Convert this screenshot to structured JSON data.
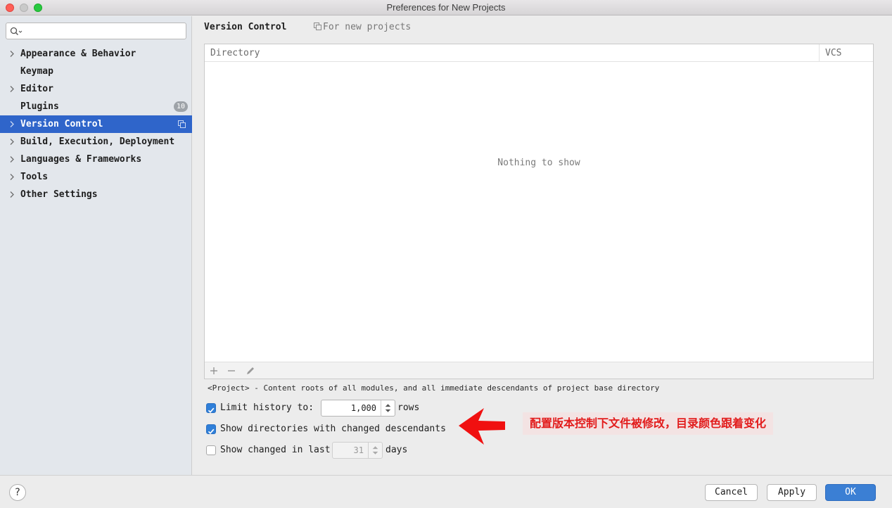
{
  "window": {
    "title": "Preferences for New Projects"
  },
  "sidebar": {
    "search_placeholder": "",
    "items": [
      {
        "label": "Appearance & Behavior",
        "expandable": true
      },
      {
        "label": "Keymap",
        "expandable": false
      },
      {
        "label": "Editor",
        "expandable": true
      },
      {
        "label": "Plugins",
        "expandable": false,
        "badge": "10"
      },
      {
        "label": "Version Control",
        "expandable": true,
        "selected": true
      },
      {
        "label": "Build, Execution, Deployment",
        "expandable": true
      },
      {
        "label": "Languages & Frameworks",
        "expandable": true
      },
      {
        "label": "Tools",
        "expandable": true
      },
      {
        "label": "Other Settings",
        "expandable": true
      }
    ]
  },
  "main": {
    "title": "Version Control",
    "scope_note": "For new projects",
    "table": {
      "columns": [
        "Directory",
        "VCS"
      ],
      "rows": [],
      "empty_text": "Nothing to show",
      "toolbar_icons": [
        "plus-icon",
        "minus-icon",
        "pencil-icon"
      ]
    },
    "hint": "<Project> - Content roots of all modules, and all immediate descendants of project base directory",
    "options": {
      "limit_history": {
        "label": "Limit history to:",
        "checked": true,
        "value": "1,000",
        "suffix": "rows"
      },
      "show_directories": {
        "label": "Show directories with changed descendants",
        "checked": true
      },
      "show_changed": {
        "label": "Show changed in last",
        "checked": false,
        "value": "31",
        "suffix": "days",
        "disabled": true
      }
    }
  },
  "annotation": {
    "text": "配置版本控制下文件被修改，目录颜色跟着变化",
    "color": "#e21c1c"
  },
  "footer": {
    "help_label": "?",
    "cancel_label": "Cancel",
    "apply_label": "Apply",
    "ok_label": "OK"
  },
  "colors": {
    "accent": "#2f65ca",
    "checkbox": "#2f7fd9",
    "ok_button": "#3b7fd4"
  }
}
